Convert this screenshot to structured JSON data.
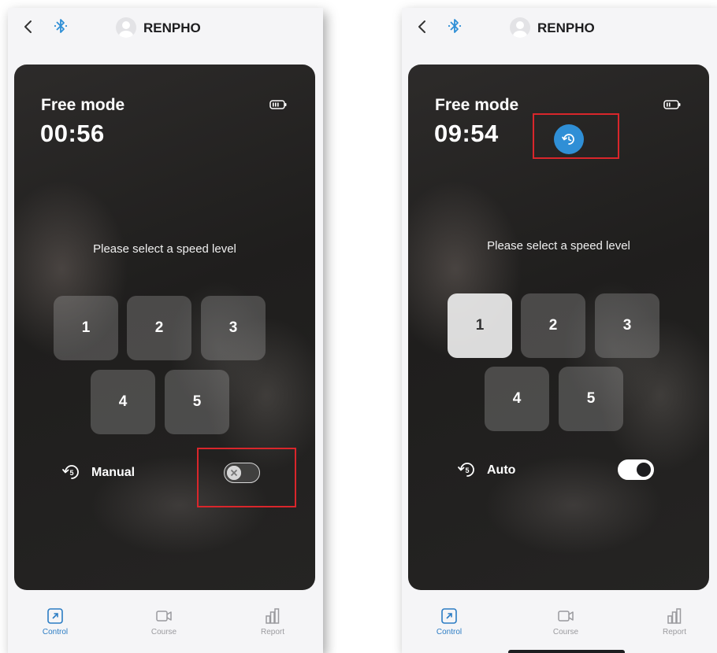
{
  "app": {
    "brand": "RENPHO"
  },
  "colors": {
    "accent": "#2f8fd6",
    "highlight": "#d9262b",
    "active_tab": "#2b7cc4"
  },
  "icons": [
    "back-chevron-icon",
    "bluetooth-icon",
    "avatar-icon",
    "battery-icon",
    "restart-timer-icon",
    "auto-cycle-icon",
    "control-icon",
    "course-icon",
    "report-icon"
  ],
  "screens": [
    {
      "mode_title": "Free mode",
      "timer": "00:56",
      "prompt": "Please select a speed level",
      "speeds": [
        "1",
        "2",
        "3",
        "4",
        "5"
      ],
      "selected_speed": null,
      "mode_label": "Manual",
      "toggle_on": false
    },
    {
      "mode_title": "Free mode",
      "timer": "09:54",
      "prompt": "Please select a speed level",
      "speeds": [
        "1",
        "2",
        "3",
        "4",
        "5"
      ],
      "selected_speed": "1",
      "mode_label": "Auto",
      "toggle_on": true
    }
  ],
  "tabs": [
    {
      "label": "Control",
      "active": true
    },
    {
      "label": "Course",
      "active": false
    },
    {
      "label": "Report",
      "active": false
    }
  ]
}
